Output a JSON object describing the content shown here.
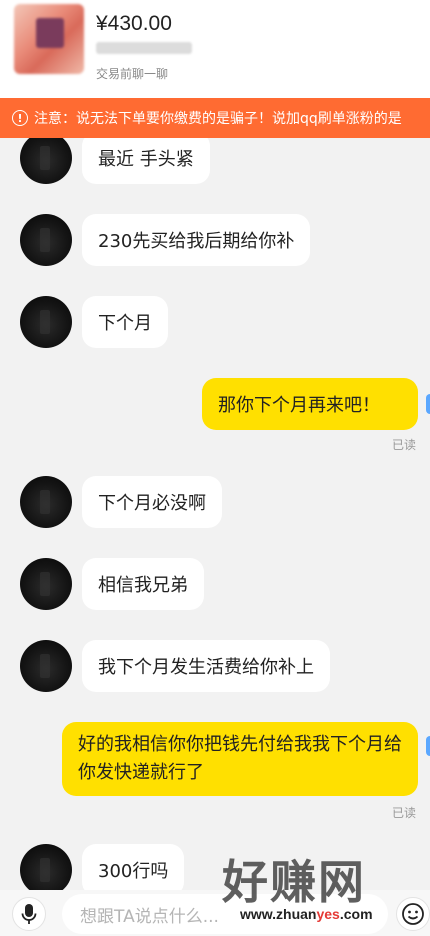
{
  "header": {
    "price": "¥430.00",
    "chat_hint": "交易前聊一聊"
  },
  "warning": {
    "icon": "exclamation-icon",
    "text": "注意：说无法下单要你缴费的是骗子！说加qq刷单涨粉的是"
  },
  "messages": [
    {
      "side": "left",
      "text": "最近 手头紧"
    },
    {
      "side": "left",
      "text": "230先买给我后期给你补"
    },
    {
      "side": "left",
      "text": "下个月"
    },
    {
      "side": "right",
      "text": "那你下个月再来吧！",
      "status": "已读"
    },
    {
      "side": "left",
      "text": "下个月必没啊"
    },
    {
      "side": "left",
      "text": "相信我兄弟"
    },
    {
      "side": "left",
      "text": "我下个月发生活费给你补上"
    },
    {
      "side": "right",
      "text": "好的我相信你你把钱先付给我我下个月给你发快递就行了",
      "status": "已读"
    },
    {
      "side": "left",
      "text": "300行吗"
    }
  ],
  "input": {
    "placeholder": "想跟TA说点什么..."
  },
  "watermark": {
    "title": "好赚网",
    "url_pre": "www.zhuan",
    "url_hl": "yes",
    "url_post": ".com"
  },
  "colors": {
    "warning_bg": "#ff6b32",
    "my_bubble": "#ffe000",
    "their_bubble": "#ffffff",
    "background": "#f2f2f2"
  }
}
